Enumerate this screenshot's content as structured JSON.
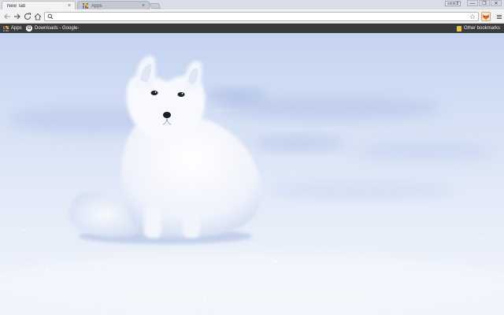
{
  "tabs": [
    {
      "title": "New Tab",
      "active": true
    },
    {
      "title": "Apps",
      "active": false
    }
  ],
  "window": {
    "profile": "sonic8",
    "buttons": [
      "—",
      "❐",
      "✕"
    ]
  },
  "toolbar": {
    "back_icon": "arrow-left-icon",
    "forward_icon": "arrow-right-icon",
    "reload_icon": "reload-icon",
    "home_icon": "home-icon",
    "omnibox": {
      "value": "",
      "placeholder": ""
    },
    "star_icon": "star-icon",
    "extension_icon": "fox-extension-icon",
    "menu_icon": "menu-icon"
  },
  "bookmarks": {
    "items": [
      {
        "label": "Apps",
        "icon": "apps-grid-icon"
      },
      {
        "label": "Downloads - Google-",
        "icon": "google-icon"
      }
    ],
    "other": {
      "label": "Other bookmarks",
      "icon": "folder-icon"
    }
  },
  "background": {
    "subject": "arctic fox in snow"
  },
  "colors": {
    "bookmarks_bar": "#3a3b3d",
    "toolbar": "#f2f2f2",
    "snow": "#e4ebf8"
  }
}
